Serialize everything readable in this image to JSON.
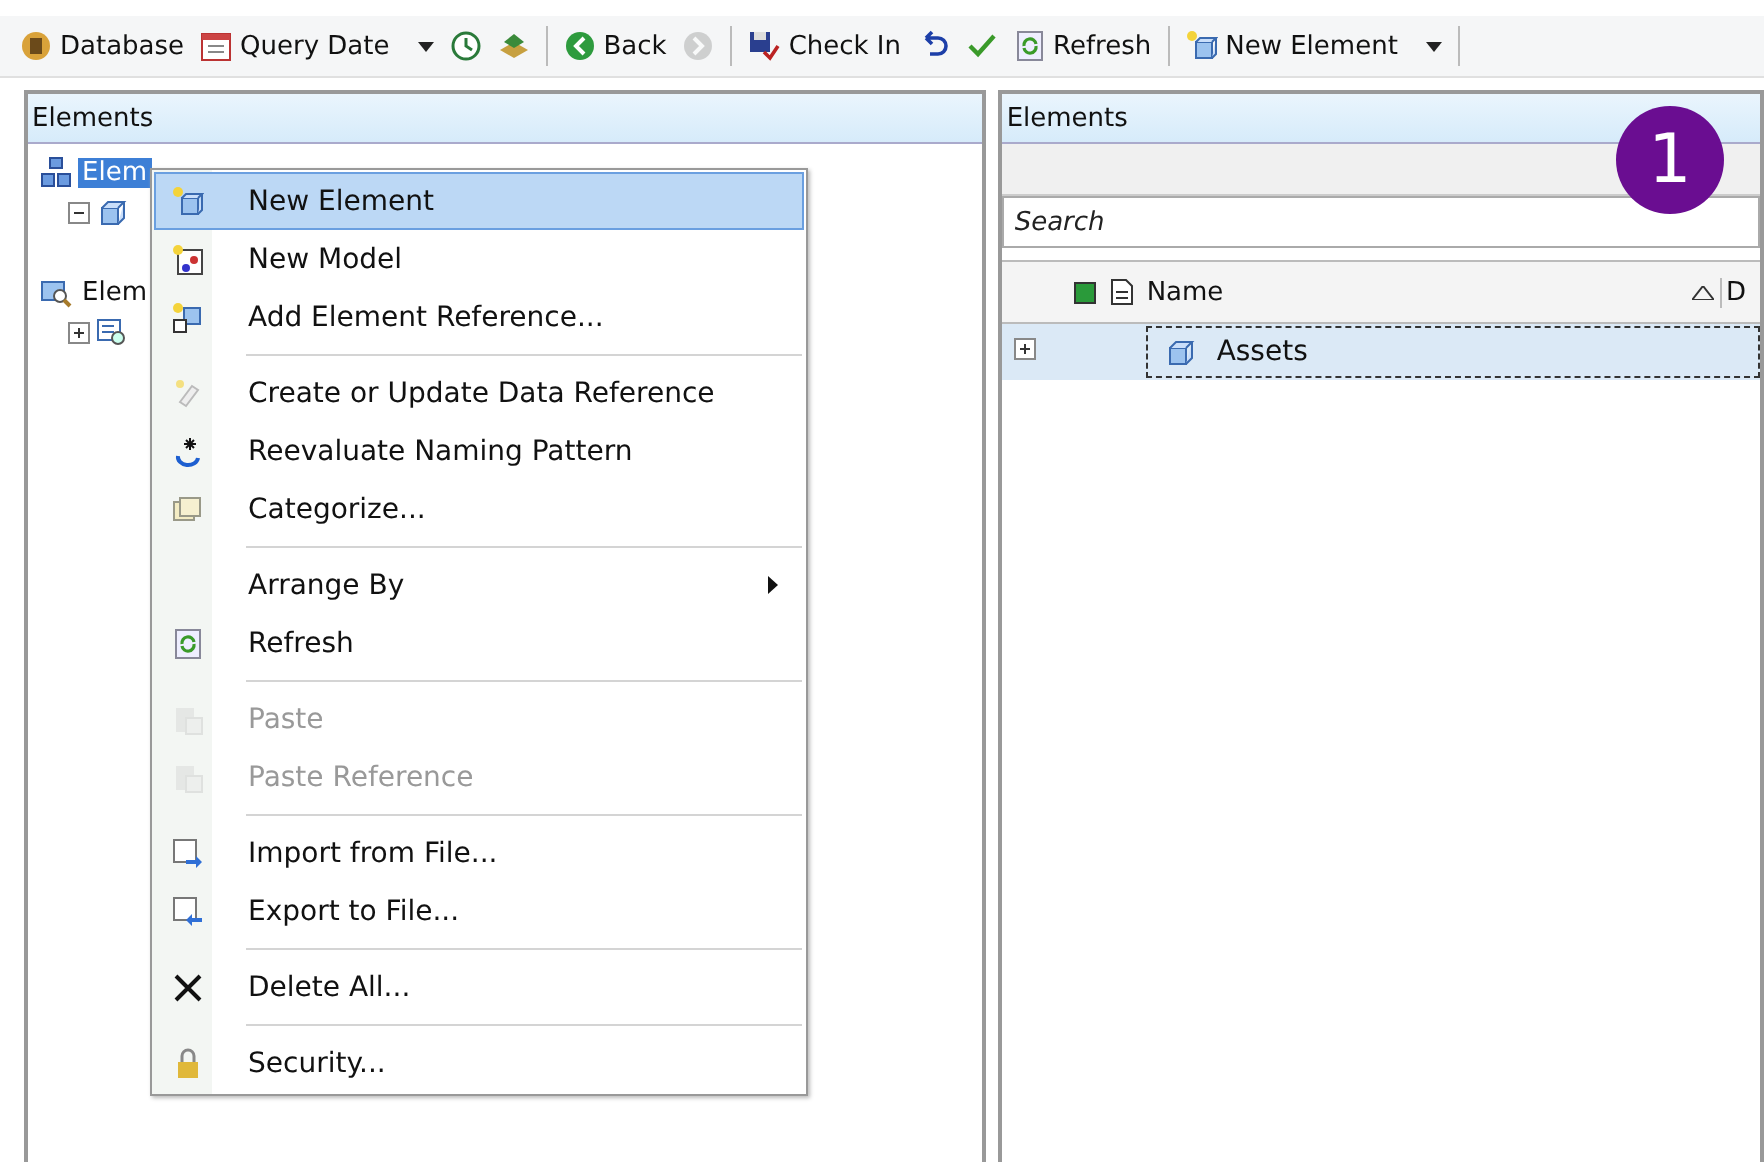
{
  "toolbar": [
    {
      "kind": "button",
      "label": "Database",
      "disabled": false
    },
    {
      "kind": "dropdown",
      "label": "Query Date",
      "disabled": false
    },
    {
      "kind": "icon",
      "disabled": false
    },
    {
      "kind": "icon",
      "disabled": false
    },
    {
      "kind": "separator"
    },
    {
      "kind": "button",
      "label": "Back",
      "disabled": false
    },
    {
      "kind": "icon",
      "disabled": true
    },
    {
      "kind": "separator"
    },
    {
      "kind": "button",
      "label": "Check In",
      "disabled": false
    },
    {
      "kind": "icon",
      "disabled": false
    },
    {
      "kind": "icon",
      "disabled": false
    },
    {
      "kind": "button",
      "label": "Refresh",
      "disabled": false
    },
    {
      "kind": "separator"
    },
    {
      "kind": "dropdown",
      "label": "New Element",
      "disabled": false
    },
    {
      "kind": "separator"
    }
  ],
  "left_panel": {
    "title": "Elements",
    "tree": [
      {
        "label": "Elem",
        "selected": true,
        "children": [
          {
            "expanded": true
          }
        ]
      },
      {
        "label": "Elem",
        "selected": false,
        "children": [
          {
            "expanded": false
          }
        ]
      }
    ]
  },
  "context_menu": [
    {
      "kind": "item",
      "label": "New Element",
      "selected": true,
      "disabled": false,
      "submenu": false
    },
    {
      "kind": "item",
      "label": "New Model",
      "selected": false,
      "disabled": false,
      "submenu": false
    },
    {
      "kind": "item",
      "label": "Add Element Reference...",
      "selected": false,
      "disabled": false,
      "submenu": false
    },
    {
      "kind": "separator"
    },
    {
      "kind": "item",
      "label": "Create or Update Data Reference",
      "selected": false,
      "disabled": false,
      "submenu": false
    },
    {
      "kind": "item",
      "label": "Reevaluate Naming Pattern",
      "selected": false,
      "disabled": false,
      "submenu": false
    },
    {
      "kind": "item",
      "label": "Categorize...",
      "selected": false,
      "disabled": false,
      "submenu": false
    },
    {
      "kind": "separator"
    },
    {
      "kind": "item",
      "label": "Arrange By",
      "selected": false,
      "disabled": false,
      "submenu": true
    },
    {
      "kind": "item",
      "label": "Refresh",
      "selected": false,
      "disabled": false,
      "submenu": false
    },
    {
      "kind": "separator"
    },
    {
      "kind": "item",
      "label": "Paste",
      "selected": false,
      "disabled": true,
      "submenu": false
    },
    {
      "kind": "item",
      "label": "Paste Reference",
      "selected": false,
      "disabled": true,
      "submenu": false
    },
    {
      "kind": "separator"
    },
    {
      "kind": "item",
      "label": "Import from File...",
      "selected": false,
      "disabled": false,
      "submenu": false
    },
    {
      "kind": "item",
      "label": "Export to File...",
      "selected": false,
      "disabled": false,
      "submenu": false
    },
    {
      "kind": "separator"
    },
    {
      "kind": "item",
      "label": "Delete All...",
      "selected": false,
      "disabled": false,
      "submenu": false
    },
    {
      "kind": "separator"
    },
    {
      "kind": "item",
      "label": "Security...",
      "selected": false,
      "disabled": false,
      "submenu": false
    }
  ],
  "right_panel": {
    "title": "Elements",
    "search": {
      "placeholder": "Search"
    },
    "columns": [
      {
        "label": "Name",
        "sorted": true
      },
      {
        "label": "D"
      }
    ],
    "rows": [
      {
        "name": "Assets",
        "expanded": false,
        "selected": true
      }
    ]
  },
  "badge": "1"
}
